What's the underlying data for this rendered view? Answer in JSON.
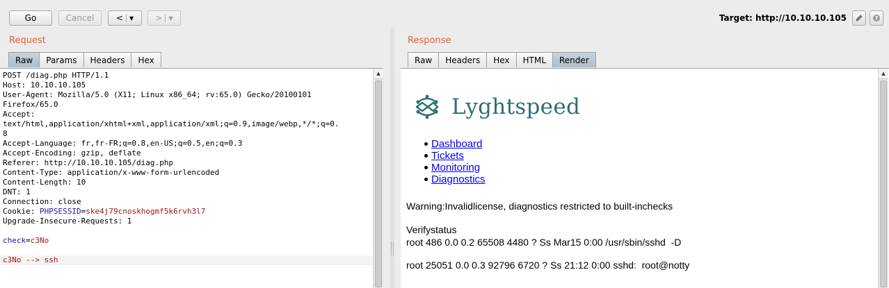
{
  "toolbar": {
    "go_label": "Go",
    "cancel_label": "Cancel",
    "back_label": "<",
    "forward_label": ">",
    "target_label": "Target: http://10.10.10.105"
  },
  "request": {
    "title": "Request",
    "tabs": [
      "Raw",
      "Params",
      "Headers",
      "Hex"
    ],
    "active_tab": "Raw",
    "lines": {
      "l1": "POST /diag.php HTTP/1.1",
      "l2": "Host: 10.10.10.105",
      "l3": "User-Agent: Mozilla/5.0 (X11; Linux x86_64; rv:65.0) Gecko/20100101",
      "l4": "Firefox/65.0",
      "l5": "Accept:",
      "l6": "text/html,application/xhtml+xml,application/xml;q=0.9,image/webp,*/*;q=0.",
      "l7": "8",
      "l8": "Accept-Language: fr,fr-FR;q=0.8,en-US;q=0.5,en;q=0.3",
      "l9": "Accept-Encoding: gzip, deflate",
      "l10": "Referer: http://10.10.10.105/diag.php",
      "l11": "Content-Type: application/x-www-form-urlencoded",
      "l12": "Content-Length: 10",
      "l13": "DNT: 1",
      "l14": "Connection: close",
      "cookie_prefix": "Cookie: ",
      "cookie_name": "PHPSESSID",
      "cookie_eq": "=",
      "cookie_value": "ske4j79cnoskhogmf5k6rvh3l7",
      "l16": "Upgrade-Insecure-Requests: 1",
      "param_name": "check",
      "param_eq": "=",
      "param_value": "c3No",
      "note": "c3No --> ssh"
    }
  },
  "response": {
    "title": "Response",
    "tabs": [
      "Raw",
      "Headers",
      "Hex",
      "HTML",
      "Render"
    ],
    "active_tab": "Render",
    "logo_text": "Lyghtspeed",
    "nav": [
      "Dashboard",
      "Tickets",
      "Monitoring",
      "Diagnostics"
    ],
    "warning": "Warning:Invalidlicense, diagnostics restricted to built-inchecks",
    "verify_title": "Verifystatus",
    "proc1": "root 486 0.0 0.2 65508 4480 ? Ss Mar15 0:00 /usr/sbin/sshd  -D",
    "proc2": "root 25051 0.0 0.3 92796 6720 ? Ss 21:12 0:00 sshd:  root@notty"
  },
  "colors": {
    "title_orange": "#e8602c",
    "active_tab": "#aebdca",
    "logo_teal": "#2f6f72",
    "link_blue": "#0000ee",
    "code_blue": "#1a1aa6",
    "code_red": "#a31515"
  },
  "icons": [
    "edit-icon",
    "help-icon",
    "scroll-up-icon",
    "lyghtspeed-logo-icon"
  ]
}
